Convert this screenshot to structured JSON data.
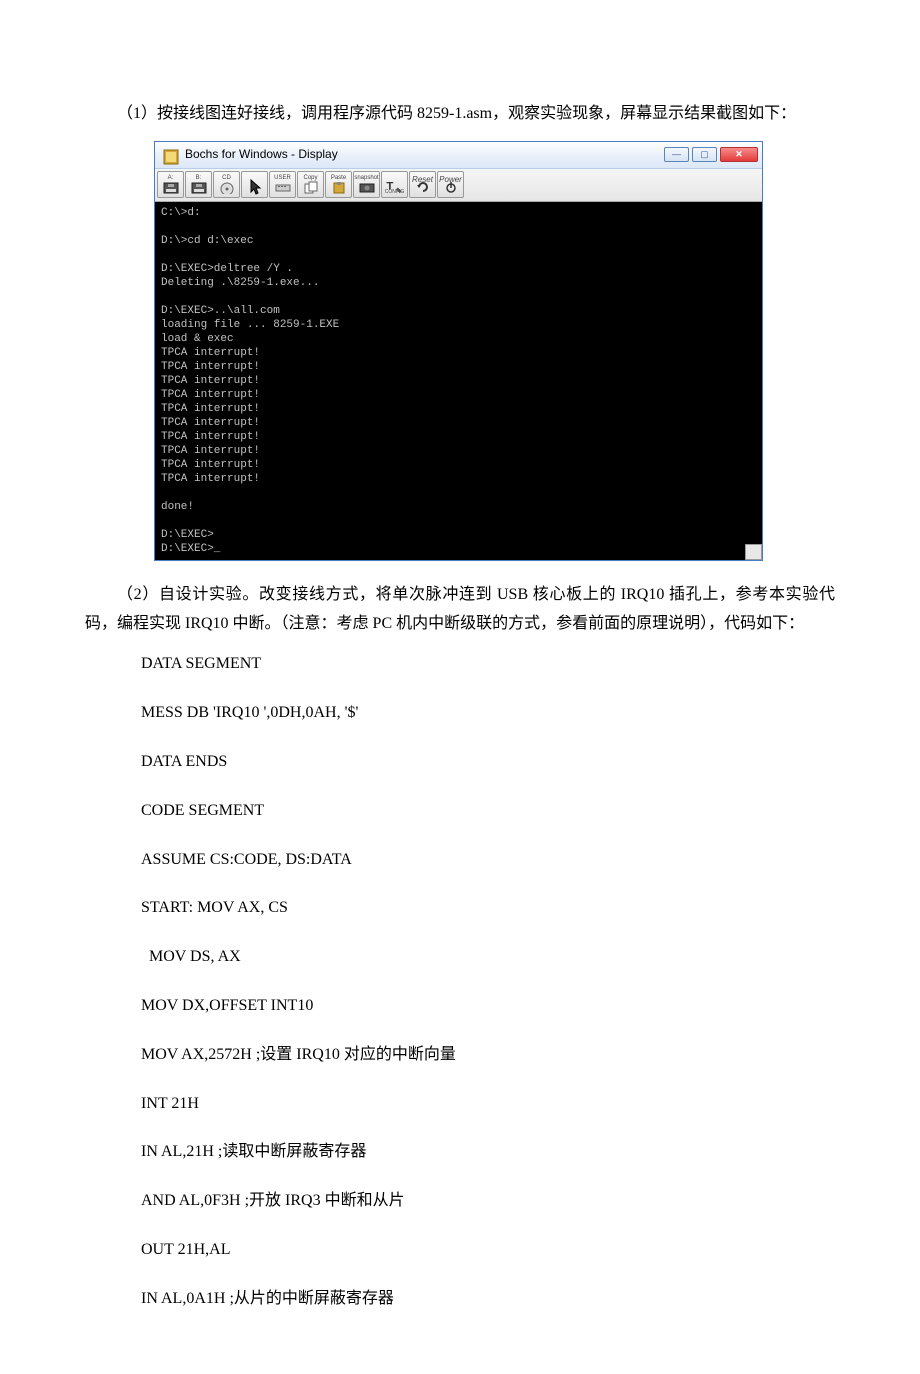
{
  "para1": "（1）按接线图连好接线，调用程序源代码 8259-1.asm，观察实验现象，屏幕显示结果截图如下：",
  "para2": "（2）自设计实验。改变接线方式，将单次脉冲连到 USB 核心板上的 IRQ10 插孔上，参考本实验代码，编程实现 IRQ10 中断。（注意：考虑 PC 机内中断级联的方式，参看前面的原理说明），代码如下：",
  "window": {
    "title": "Bochs for Windows - Display"
  },
  "toolbar_labels": {
    "a": "A:",
    "b": "B:",
    "cd": "CD",
    "mouse": "",
    "user": "USER",
    "copy": "Copy",
    "paste": "Paste",
    "snapshot": "snapshot",
    "config": "CONFIG",
    "reset": "Reset",
    "power": "Power"
  },
  "terminal_lines": [
    "C:\\>d:",
    "",
    "D:\\>cd d:\\exec",
    "",
    "D:\\EXEC>deltree /Y .",
    "Deleting .\\8259-1.exe...",
    "",
    "D:\\EXEC>..\\all.com",
    "loading file ... 8259-1.EXE",
    "load & exec",
    "TPCA interrupt!",
    "TPCA interrupt!",
    "TPCA interrupt!",
    "TPCA interrupt!",
    "TPCA interrupt!",
    "TPCA interrupt!",
    "TPCA interrupt!",
    "TPCA interrupt!",
    "TPCA interrupt!",
    "TPCA interrupt!",
    "",
    "done!",
    "",
    "D:\\EXEC>",
    "D:\\EXEC>_"
  ],
  "code": [
    "DATA SEGMENT",
    " MESS DB 'IRQ10 ',0DH,0AH, '$'",
    "DATA ENDS",
    "CODE SEGMENT",
    " ASSUME CS:CODE, DS:DATA",
    "START: MOV AX, CS",
    "  MOV DS, AX",
    " MOV DX,OFFSET INT10",
    " MOV AX,2572H ;设置 IRQ10 对应的中断向量",
    " INT 21H",
    " IN AL,21H    ;读取中断屏蔽寄存器",
    " AND AL,0F3H ;开放 IRQ3 中断和从片",
    " OUT 21H,AL",
    " IN AL,0A1H  ;从片的中断屏蔽寄存器"
  ]
}
